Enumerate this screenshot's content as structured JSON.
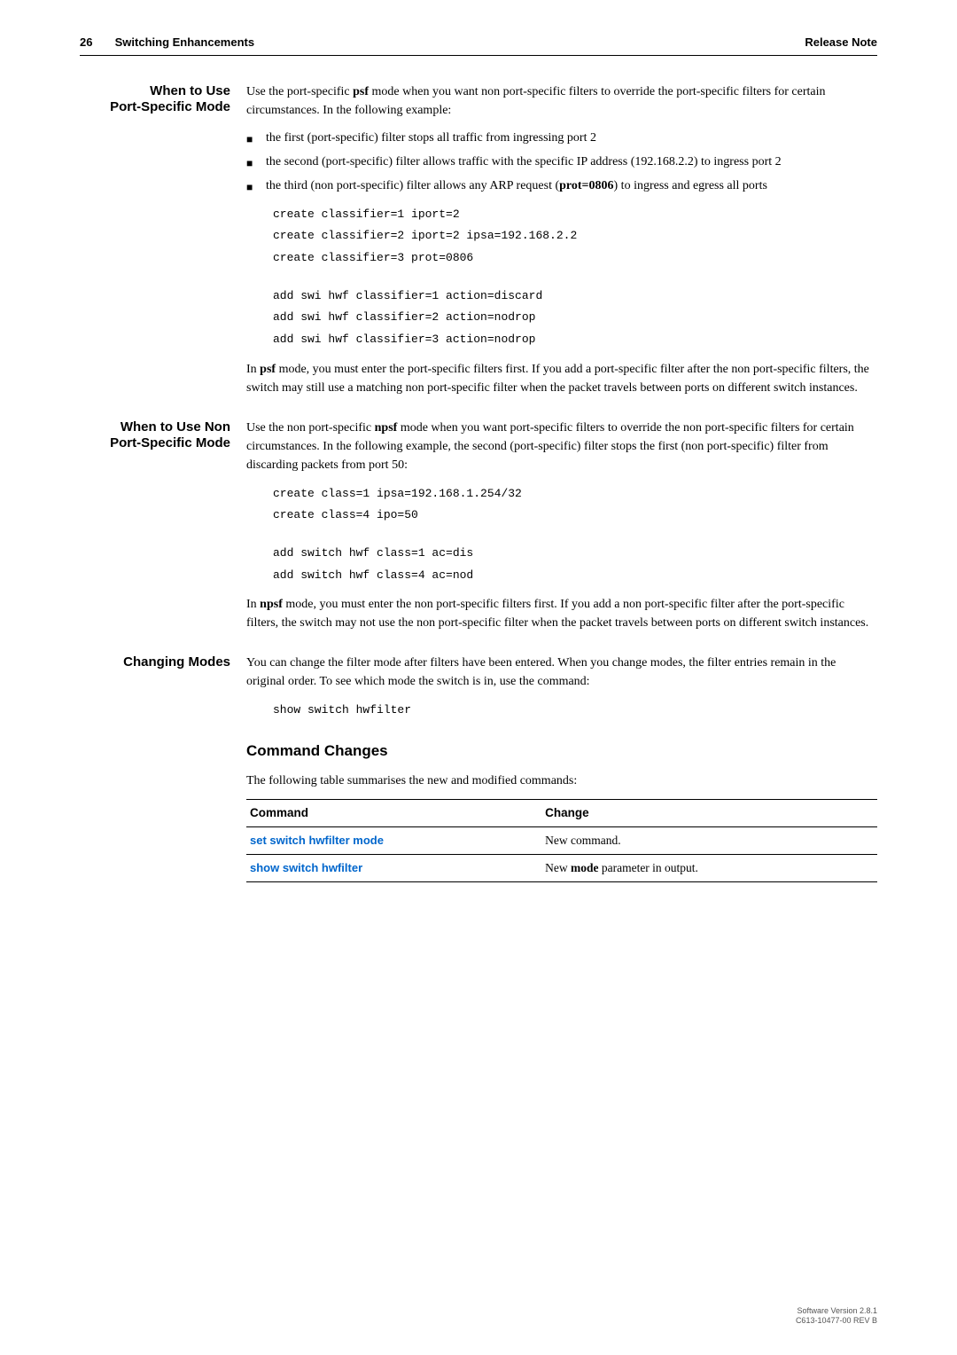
{
  "header": {
    "page_number": "26",
    "chapter_title": "Switching Enhancements",
    "doc_type": "Release Note"
  },
  "sec1": {
    "label_line1": "When to Use",
    "label_line2": "Port-Specific Mode",
    "intro_a": "Use the port-specific ",
    "intro_bold": "psf",
    "intro_b": " mode when you want non port-specific filters to override the port-specific filters for certain circumstances. In the following example:",
    "bullet1": "the first (port-specific) filter stops all traffic from ingressing port 2",
    "bullet2": "the second (port-specific) filter allows traffic with the specific IP address (192.168.2.2) to ingress port 2",
    "bullet3_a": "the third (non port-specific) filter allows any ARP request (",
    "bullet3_bold": "prot=0806",
    "bullet3_b": ") to ingress and egress all ports",
    "code": [
      "create classifier=1 iport=2",
      "create classifier=2 iport=2 ipsa=192.168.2.2",
      "create classifier=3 prot=0806"
    ],
    "code2": [
      "add swi hwf classifier=1 action=discard",
      "add swi hwf classifier=2 action=nodrop",
      "add swi hwf classifier=3 action=nodrop"
    ],
    "tail_a": "In ",
    "tail_bold": "psf",
    "tail_b": " mode, you must enter the port-specific filters first. If you add a port-specific filter after the non port-specific filters, the switch may still use a matching non port-specific filter when the packet travels between ports on different switch instances."
  },
  "sec2": {
    "label_line1": "When to Use Non",
    "label_line2": "Port-Specific Mode",
    "intro_a": "Use the non port-specific ",
    "intro_bold": "npsf",
    "intro_b": " mode when you want port-specific filters to override the non port-specific filters for certain circumstances. In the following example, the second (port-specific) filter stops the first (non port-specific) filter from discarding packets from port 50:",
    "code": [
      "create class=1 ipsa=192.168.1.254/32",
      "create class=4 ipo=50"
    ],
    "code2": [
      "add switch hwf class=1 ac=dis",
      "add switch hwf class=4 ac=nod"
    ],
    "tail_a": "In ",
    "tail_bold": "npsf",
    "tail_b": " mode, you must enter the non port-specific filters first. If you add a non port-specific filter after the port-specific filters, the switch may not use the non port-specific filter when the packet travels between ports on different switch instances."
  },
  "sec3": {
    "label": "Changing Modes",
    "para": "You can change the filter mode after filters have been entered. When you change modes, the filter entries remain in the original order. To see which mode the switch is in, use the command:",
    "code": "show switch hwfilter"
  },
  "cmdchg": {
    "heading": "Command Changes",
    "intro": "The following table summarises the new and modified commands:",
    "th1": "Command",
    "th2": "Change",
    "row1_cmd": "set switch hwfilter mode",
    "row1_chg": "New command.",
    "row2_cmd": "show switch hwfilter",
    "row2_chg_a": "New ",
    "row2_chg_bold": "mode",
    "row2_chg_b": " parameter in output."
  },
  "footer": {
    "line1": "Software Version 2.8.1",
    "line2": "C613-10477-00 REV B"
  }
}
